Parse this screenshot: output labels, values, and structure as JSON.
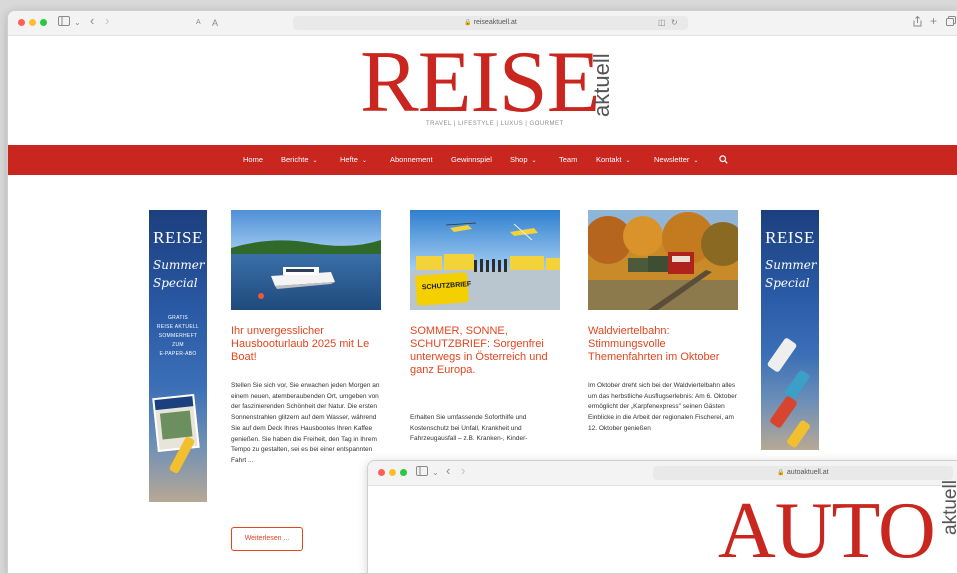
{
  "browser_main": {
    "url": "reiseaktuell.at",
    "back_glyph": "‹",
    "forward_glyph": "›",
    "text_size_small": "A",
    "text_size_large": "A"
  },
  "masthead": {
    "logo_main": "REISE",
    "logo_sub": "aktuell",
    "tagline": "TRAVEL | LIFESTYLE | LUXUS | GOURMET"
  },
  "nav": {
    "items": [
      {
        "label": "Home"
      },
      {
        "label": "Berichte"
      },
      {
        "label": "Hefte"
      },
      {
        "label": "Abonnement"
      },
      {
        "label": "Gewinnspiel"
      },
      {
        "label": "Shop"
      },
      {
        "label": "Team"
      },
      {
        "label": "Kontakt"
      },
      {
        "label": "Newsletter"
      }
    ],
    "caret_glyph": "⌄",
    "search_icon": "search-icon"
  },
  "ad_banner": {
    "title": "REISE",
    "script": "Summer Special",
    "small_lines": [
      "GRATIS",
      "REISE AKTUELL",
      "SOMMERHEFT",
      "ZUM",
      "E-PAPER-ABO"
    ]
  },
  "articles": [
    {
      "title": "Ihr unvergesslicher Hausbooturlaub 2025 mit Le Boat!",
      "excerpt": "Stellen Sie sich vor, Sie erwachen jeden Morgen an einem neuen, atemberaubenden Ort, umgeben von der faszinierenden Schönheit der Natur. Die ersten Sonnenstrahlen glitzern auf dem Wasser, während Sie auf dem Deck Ihres Hausbootes Ihren Kaffee genießen. Sie haben die Freiheit, den Tag in Ihrem Tempo zu gestalten, sei es bei einer entspannten Fahrt ...",
      "read_more": "Weiterlesen ..."
    },
    {
      "title": "SOMMER, SONNE, SCHUTZBRIEF: Sorgenfrei unterwegs in Österreich und ganz Europa.",
      "excerpt": "Erhalten Sie umfassende Soforthilfe und Kostenschutz bei Unfall, Krankheit und Fahrzeugausfall – z.B. Kranken-, Kinder-",
      "image_text": "SCHUTZBRIEF"
    },
    {
      "title": "Waldviertelbahn: Stimmungsvolle Themenfahrten im Oktober",
      "excerpt": "Im Oktober dreht sich bei der Waldviertelbahn alles um das herbstliche Ausflugserlebnis: Am 6. Oktober ermöglicht der „Karpfenexpress\" seinen Gästen Einblicke in die Arbeit der regionalen Fischerei, am 12. Oktober genießen"
    }
  ],
  "browser_auto": {
    "url": "autoaktuell.at",
    "logo_main": "AUTO",
    "logo_sub": "aktuell"
  },
  "colors": {
    "brand_red": "#c8261f",
    "headline_orange": "#e3461f"
  }
}
